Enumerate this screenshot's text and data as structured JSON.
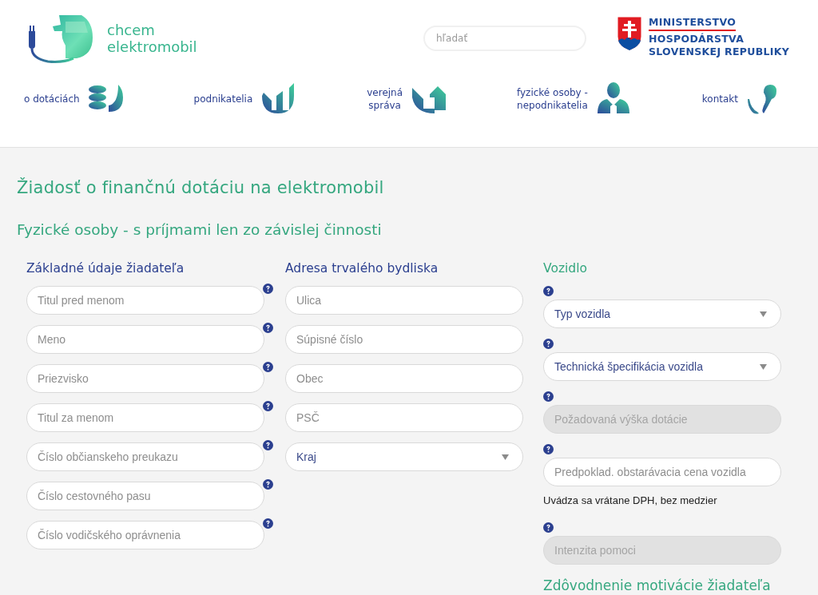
{
  "header": {
    "logo_text": [
      "chcem",
      "elektromobil"
    ],
    "search": {
      "placeholder": "hľadať"
    },
    "ministry": [
      "MINISTERSTVO",
      "HOSPODÁRSTVA",
      "SLOVENSKEJ REPUBLIKY"
    ]
  },
  "nav": [
    {
      "label": "o dotáciách",
      "kind": "coins"
    },
    {
      "label": "podnikatelia",
      "kind": "bars"
    },
    {
      "label": "verejná\nspráva",
      "kind": "house"
    },
    {
      "label": "fyzické osoby -\nnepodnikatelia",
      "kind": "person"
    },
    {
      "label": "kontakt",
      "kind": "phone"
    }
  ],
  "page_title": "Žiadosť o finančnú dotáciu na elektromobil",
  "subtitle": "Fyzické osoby - s príjmami len zo závislej činnosti",
  "applicant": {
    "heading": "Základné údaje žiadateľa",
    "fields": [
      {
        "placeholder": "Titul pred menom",
        "help": true
      },
      {
        "placeholder": "Meno",
        "help": true
      },
      {
        "placeholder": "Priezvisko",
        "help": true
      },
      {
        "placeholder": "Titul za menom",
        "help": true
      },
      {
        "placeholder": "Číslo občianskeho preukazu",
        "help": true
      },
      {
        "placeholder": "Číslo cestovného pasu",
        "help": true
      },
      {
        "placeholder": "Číslo vodičského oprávnenia",
        "help": true
      }
    ]
  },
  "address": {
    "heading": "Adresa trvalého bydliska",
    "fields": [
      {
        "kind": "input",
        "placeholder": "Ulica"
      },
      {
        "kind": "input",
        "placeholder": "Súpisné číslo"
      },
      {
        "kind": "input",
        "placeholder": "Obec"
      },
      {
        "kind": "input",
        "placeholder": "PSČ"
      },
      {
        "kind": "select",
        "value": "Kraj"
      }
    ]
  },
  "vehicle": {
    "heading": "Vozidlo",
    "items": [
      {
        "kind": "select",
        "value": "Typ vozidla",
        "help": true
      },
      {
        "kind": "select",
        "value": "Technická špecifikácia vozidla",
        "help": true
      },
      {
        "kind": "input",
        "placeholder": "Požadovaná výška dotácie",
        "disabled": true,
        "help": true
      },
      {
        "kind": "input",
        "placeholder": "Predpoklad. obstarávacia cena vozidla",
        "disabled": false,
        "help": true
      },
      {
        "kind": "note",
        "text": "Uvádza sa vrátane DPH, bez medzier"
      },
      {
        "kind": "input",
        "placeholder": "Intenzita pomoci",
        "disabled": true,
        "help": true
      }
    ]
  },
  "next_heading": "Zdôvodnenie motivácie žiadateľa"
}
